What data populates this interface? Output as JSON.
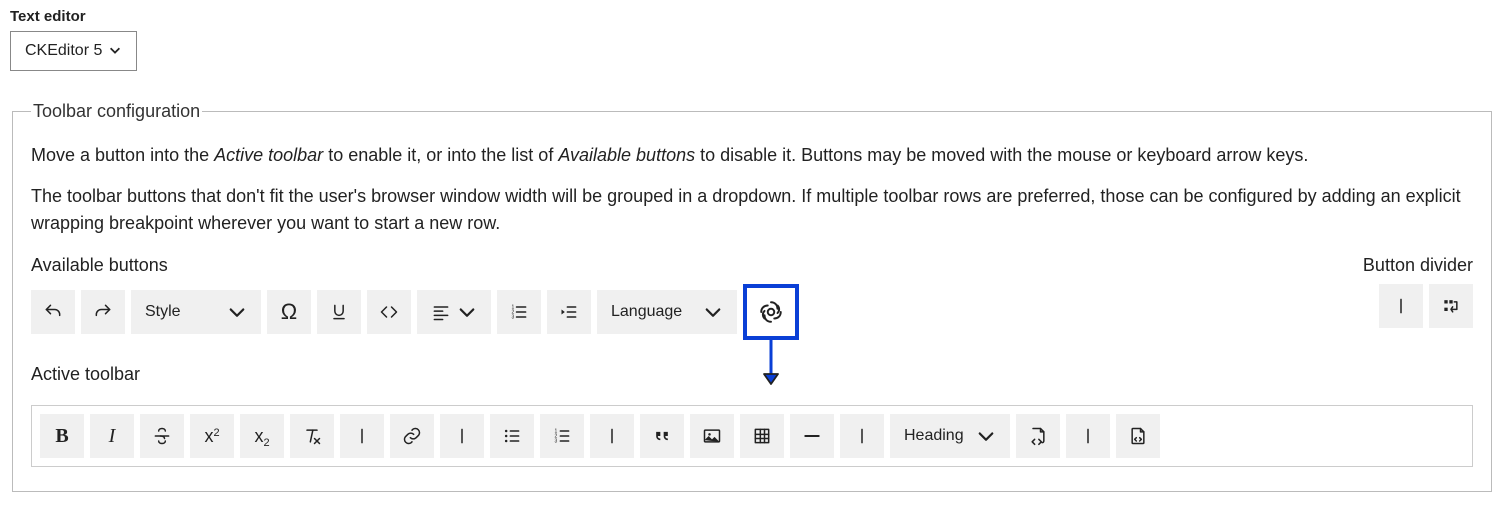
{
  "field": {
    "label": "Text editor",
    "value": "CKEditor 5"
  },
  "fieldset": {
    "legend": "Toolbar configuration",
    "help1_a": "Move a button into the ",
    "help1_em1": "Active toolbar",
    "help1_b": " to enable it, or into the list of ",
    "help1_em2": "Available buttons",
    "help1_c": " to disable it. Buttons may be moved with the mouse or keyboard arrow keys.",
    "help2": "The toolbar buttons that don't fit the user's browser window width will be grouped in a dropdown. If multiple toolbar rows are preferred, those can be configured by adding an explicit wrapping breakpoint wherever you want to start a new row."
  },
  "labels": {
    "available": "Available buttons",
    "divider": "Button divider",
    "active": "Active toolbar"
  },
  "available": {
    "style": "Style",
    "language": "Language"
  },
  "active": {
    "heading": "Heading"
  },
  "icons": {
    "undo": "undo-icon",
    "redo": "redo-icon",
    "special_char": "special-characters-icon",
    "underline": "underline-icon",
    "code": "code-icon",
    "align": "alignment-icon",
    "numbered_list": "numbered-list-icon",
    "indent": "indent-icon",
    "ai": "ai-assistant-icon",
    "separator": "separator-icon",
    "wrap": "wrapping-breakpoint-icon",
    "bold": "bold-icon",
    "italic": "italic-icon",
    "strike": "strikethrough-icon",
    "superscript": "superscript-icon",
    "subscript": "subscript-icon",
    "remove_format": "remove-format-icon",
    "link": "link-icon",
    "bulleted_list": "bulleted-list-icon",
    "number_list2": "numbered-list-icon",
    "blockquote": "blockquote-icon",
    "image": "image-icon",
    "table": "table-icon",
    "hr": "horizontal-line-icon",
    "code_block": "code-block-icon",
    "source": "source-icon"
  }
}
